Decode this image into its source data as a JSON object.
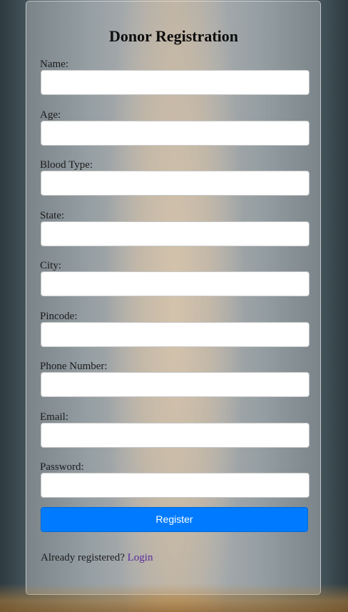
{
  "form": {
    "title": "Donor Registration",
    "fields": [
      {
        "label": "Name:",
        "value": "",
        "placeholder": ""
      },
      {
        "label": "Age:",
        "value": "",
        "placeholder": ""
      },
      {
        "label": "Blood Type:",
        "value": "",
        "placeholder": ""
      },
      {
        "label": "State:",
        "value": "",
        "placeholder": ""
      },
      {
        "label": "City:",
        "value": "",
        "placeholder": ""
      },
      {
        "label": "Pincode:",
        "value": "",
        "placeholder": ""
      },
      {
        "label": "Phone Number:",
        "value": "",
        "placeholder": ""
      },
      {
        "label": "Email:",
        "value": "",
        "placeholder": ""
      },
      {
        "label": "Password:",
        "value": "",
        "placeholder": ""
      }
    ],
    "register_label": "Register",
    "login_prompt": "Already registered?",
    "login_link": "Login"
  },
  "colors": {
    "primary_button": "#007bff",
    "link": "#5a2a9e",
    "card_overlay": "rgba(210,210,210,0.38)"
  }
}
